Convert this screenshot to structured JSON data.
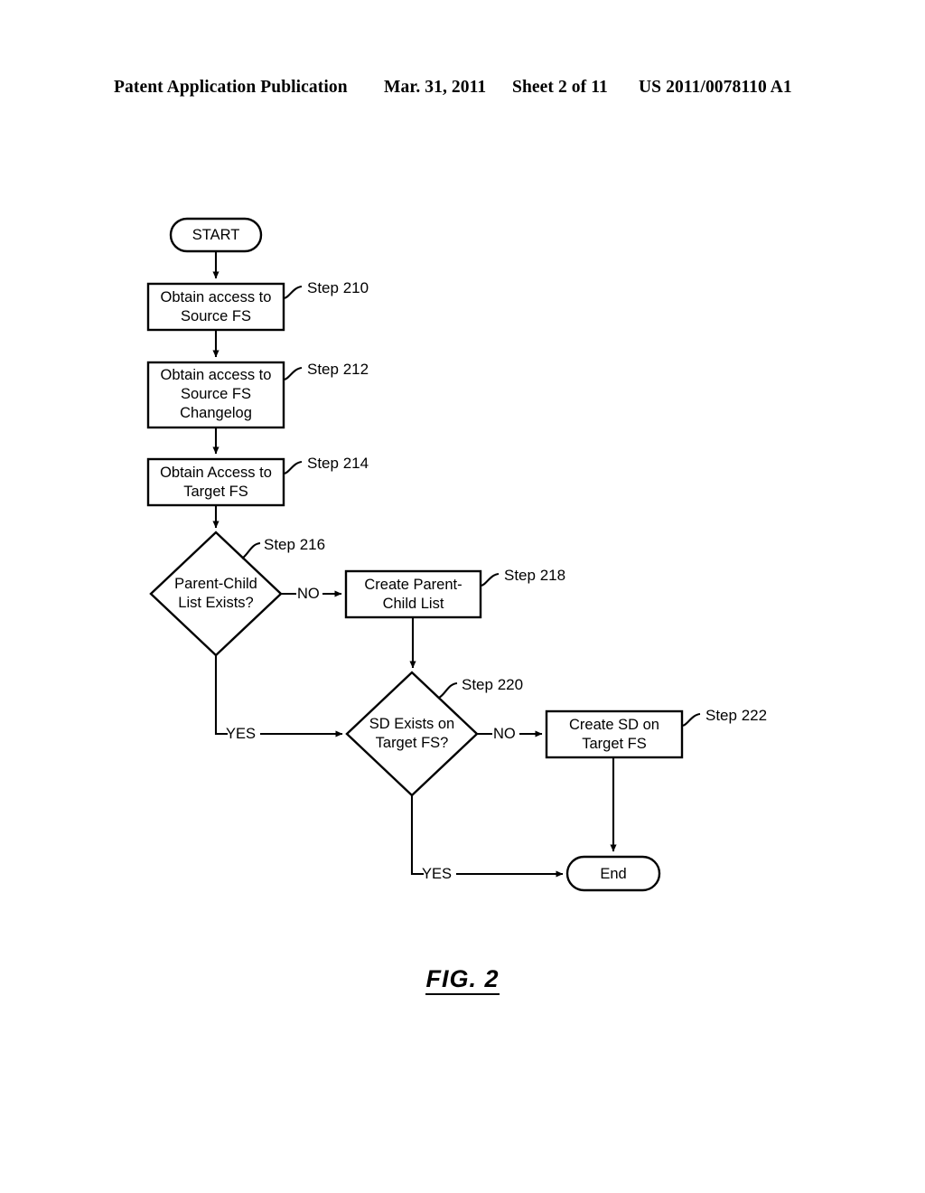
{
  "header": {
    "publication": "Patent Application Publication",
    "date": "Mar. 31, 2011",
    "sheet": "Sheet 2 of 11",
    "patent_number": "US 2011/0078110 A1"
  },
  "figure": {
    "caption": "FIG. 2"
  },
  "flowchart": {
    "type": "flowchart",
    "nodes": [
      {
        "id": "start",
        "shape": "terminator",
        "text": "START"
      },
      {
        "id": "s210",
        "shape": "process",
        "text": "Obtain access to\nSource FS",
        "ref": "Step 210"
      },
      {
        "id": "s212",
        "shape": "process",
        "text": "Obtain access to\nSource FS\nChangelog",
        "ref": "Step 212"
      },
      {
        "id": "s214",
        "shape": "process",
        "text": "Obtain Access to\nTarget FS",
        "ref": "Step 214"
      },
      {
        "id": "s216",
        "shape": "decision",
        "text": "Parent-Child\nList Exists?",
        "ref": "Step 216"
      },
      {
        "id": "s218",
        "shape": "process",
        "text": "Create Parent-\nChild List",
        "ref": "Step 218"
      },
      {
        "id": "s220",
        "shape": "decision",
        "text": "SD Exists on\nTarget FS?",
        "ref": "Step 220"
      },
      {
        "id": "s222",
        "shape": "process",
        "text": "Create SD on\nTarget FS",
        "ref": "Step 222"
      },
      {
        "id": "end",
        "shape": "terminator",
        "text": "End"
      }
    ],
    "edges": [
      {
        "from": "start",
        "to": "s210",
        "label": ""
      },
      {
        "from": "s210",
        "to": "s212",
        "label": ""
      },
      {
        "from": "s212",
        "to": "s214",
        "label": ""
      },
      {
        "from": "s214",
        "to": "s216",
        "label": ""
      },
      {
        "from": "s216",
        "to": "s218",
        "label": "NO"
      },
      {
        "from": "s216",
        "to": "s220",
        "label": "YES"
      },
      {
        "from": "s218",
        "to": "s220",
        "label": ""
      },
      {
        "from": "s220",
        "to": "s222",
        "label": "NO"
      },
      {
        "from": "s220",
        "to": "end",
        "label": "YES"
      },
      {
        "from": "s222",
        "to": "end",
        "label": ""
      }
    ],
    "labels": {
      "no_1": "NO",
      "no_2": "NO",
      "yes_1": "YES",
      "yes_2": "YES"
    }
  },
  "colors": {
    "stroke": "#000000",
    "background": "#ffffff",
    "text": "#000000"
  }
}
